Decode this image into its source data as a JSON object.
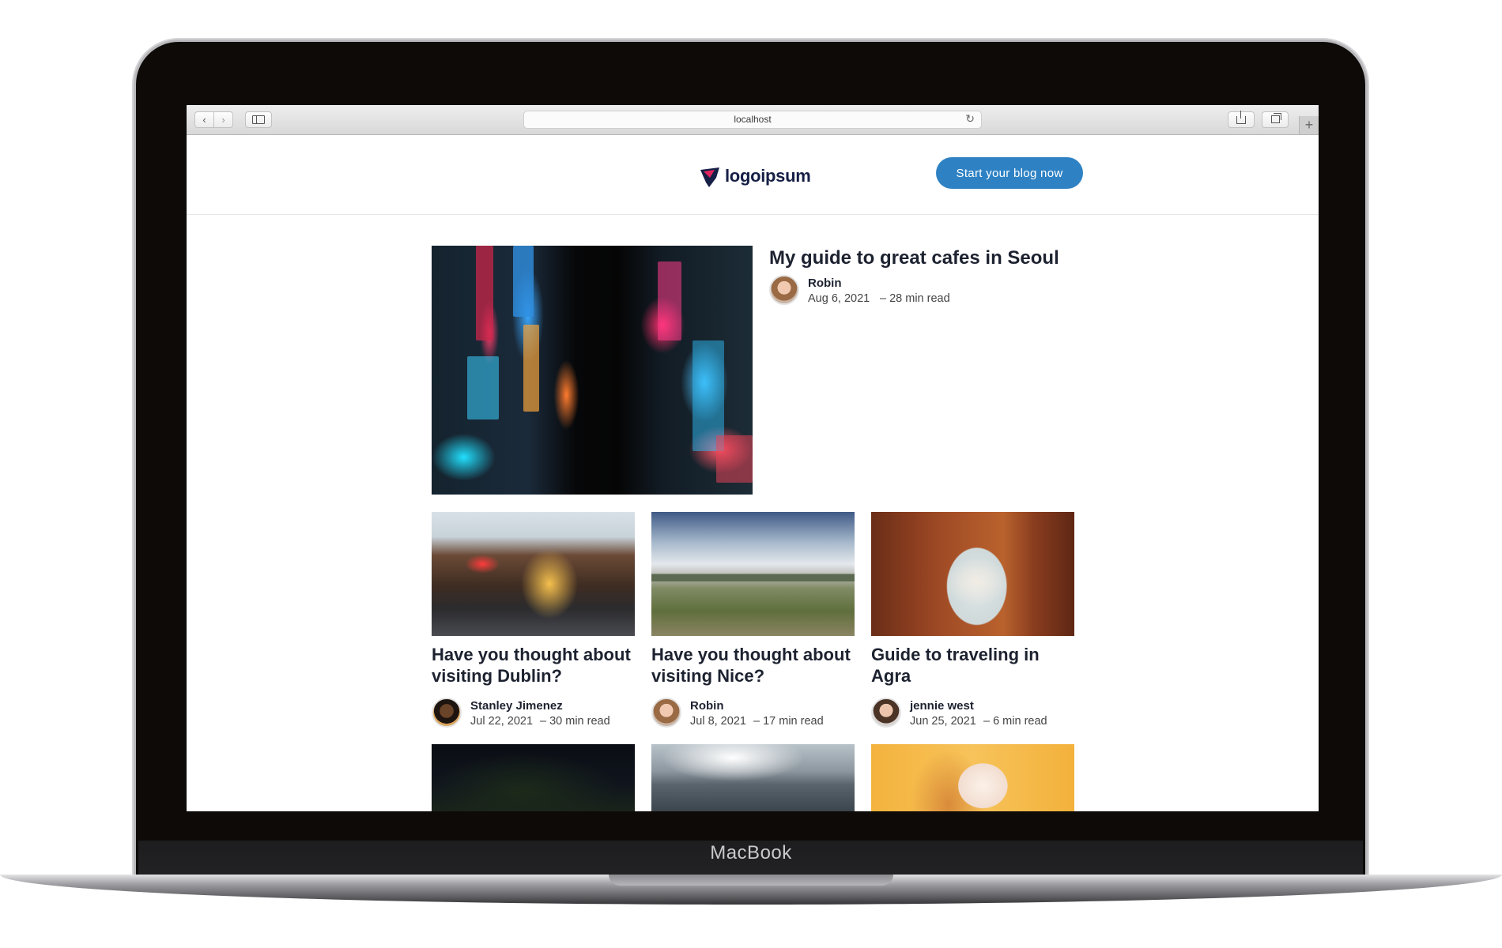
{
  "device": {
    "brand": "MacBook"
  },
  "browser": {
    "address": "localhost"
  },
  "header": {
    "logo_text": "logoipsum",
    "cta_label": "Start your blog now"
  },
  "featured": {
    "title": "My guide to great cafes in Seoul",
    "author": "Robin",
    "date": "Aug 6, 2021",
    "read_time": "– 28 min read"
  },
  "posts": [
    {
      "title": "Have you thought about visiting Dublin?",
      "author": "Stanley Jimenez",
      "date": "Jul 22, 2021",
      "read_time": "– 30 min read"
    },
    {
      "title": "Have you thought about visiting Nice?",
      "author": "Robin",
      "date": "Jul 8, 2021",
      "read_time": "– 17 min read"
    },
    {
      "title": "Guide to traveling in Agra",
      "author": "jennie west",
      "date": "Jun 25, 2021",
      "read_time": "– 6 min read"
    }
  ],
  "colors": {
    "accent": "#2e82c4",
    "logo": "#161f46",
    "text": "#1d2230"
  }
}
